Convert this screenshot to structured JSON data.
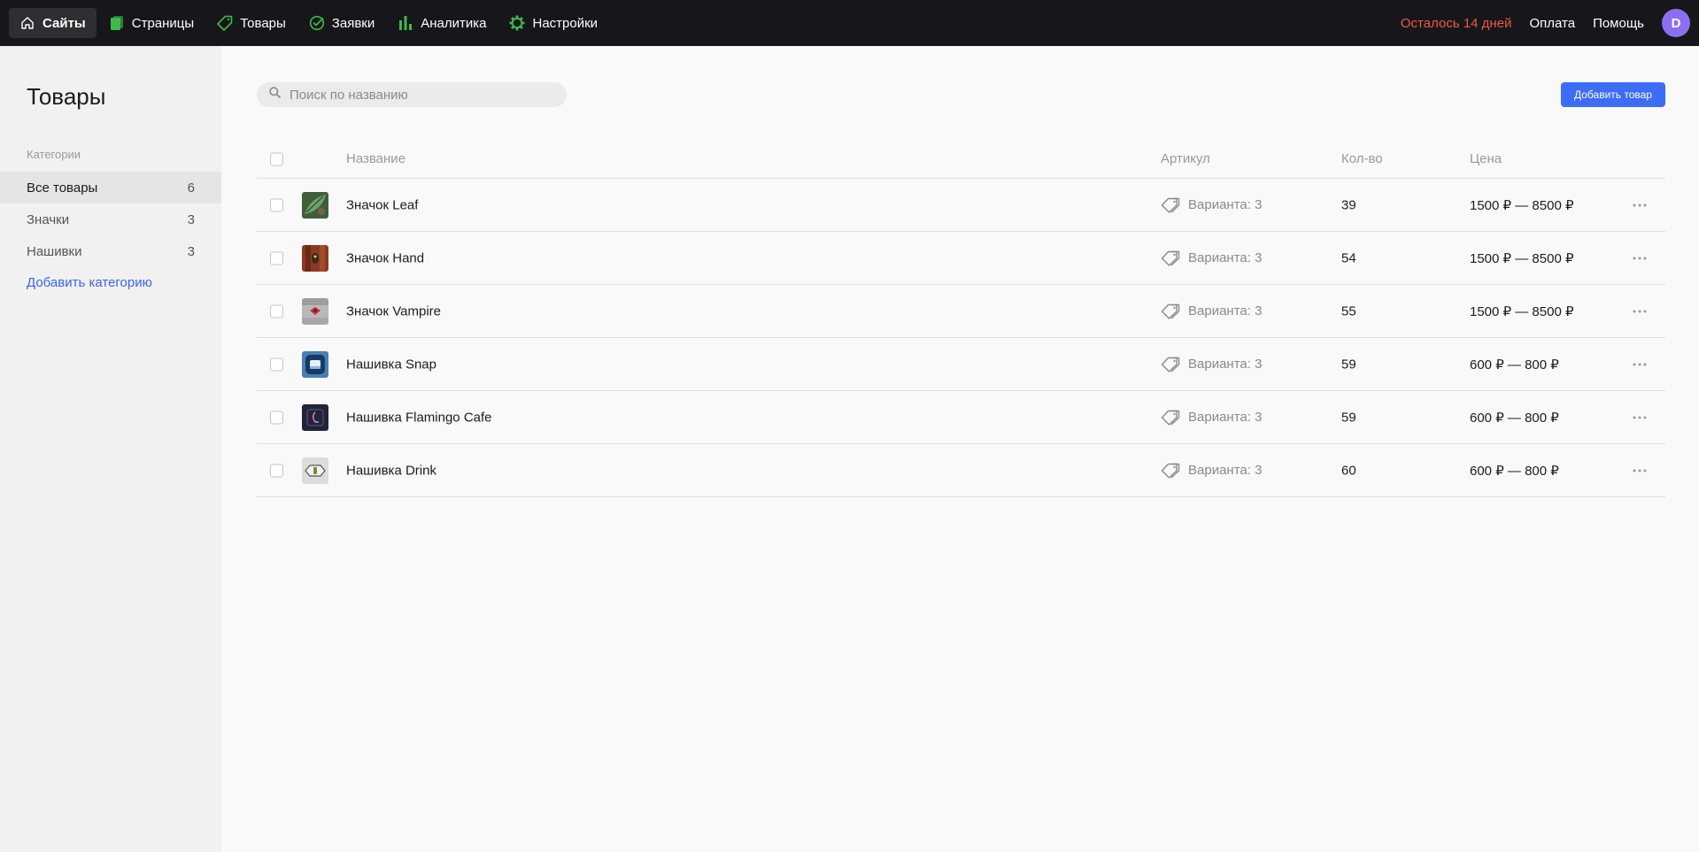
{
  "topbar": {
    "nav": [
      {
        "label": "Сайты",
        "icon": "home-icon"
      },
      {
        "label": "Страницы",
        "icon": "pages-icon"
      },
      {
        "label": "Товары",
        "icon": "tag-icon"
      },
      {
        "label": "Заявки",
        "icon": "requests-icon"
      },
      {
        "label": "Аналитика",
        "icon": "analytics-icon"
      },
      {
        "label": "Настройки",
        "icon": "gear-icon"
      }
    ],
    "trial": "Осталось 14 дней",
    "payment": "Оплата",
    "help": "Помощь",
    "avatar_letter": "D",
    "colors": {
      "accent_green": "#3fb94a",
      "trial_red": "#f0583e",
      "avatar": "#8b6ff0"
    }
  },
  "sidebar": {
    "title": "Товары",
    "categories_label": "Категории",
    "categories": [
      {
        "label": "Все товары",
        "count": "6"
      },
      {
        "label": "Значки",
        "count": "3"
      },
      {
        "label": "Нашивки",
        "count": "3"
      }
    ],
    "add_category": "Добавить категорию"
  },
  "main": {
    "search_placeholder": "Поиск по названию",
    "add_button": "Добавить товар",
    "columns": {
      "name": "Название",
      "sku": "Артикул",
      "qty": "Кол-во",
      "price": "Цена"
    },
    "rows": [
      {
        "name": "Значок Leaf",
        "variants": "Варианта: 3",
        "qty": "39",
        "price": "1500 ₽ — 8500 ₽",
        "thumb": "leaf"
      },
      {
        "name": "Значок Hand",
        "variants": "Варианта: 3",
        "qty": "54",
        "price": "1500 ₽ — 8500 ₽",
        "thumb": "hand"
      },
      {
        "name": "Значок Vampire",
        "variants": "Варианта: 3",
        "qty": "55",
        "price": "1500 ₽ — 8500 ₽",
        "thumb": "vampire"
      },
      {
        "name": "Нашивка Snap",
        "variants": "Варианта: 3",
        "qty": "59",
        "price": "600 ₽ — 800 ₽",
        "thumb": "snap"
      },
      {
        "name": "Нашивка Flamingo Cafe",
        "variants": "Варианта: 3",
        "qty": "59",
        "price": "600 ₽ — 800 ₽",
        "thumb": "flamingo"
      },
      {
        "name": "Нашивка Drink",
        "variants": "Варианта: 3",
        "qty": "60",
        "price": "600 ₽ — 800 ₽",
        "thumb": "drink"
      }
    ]
  }
}
